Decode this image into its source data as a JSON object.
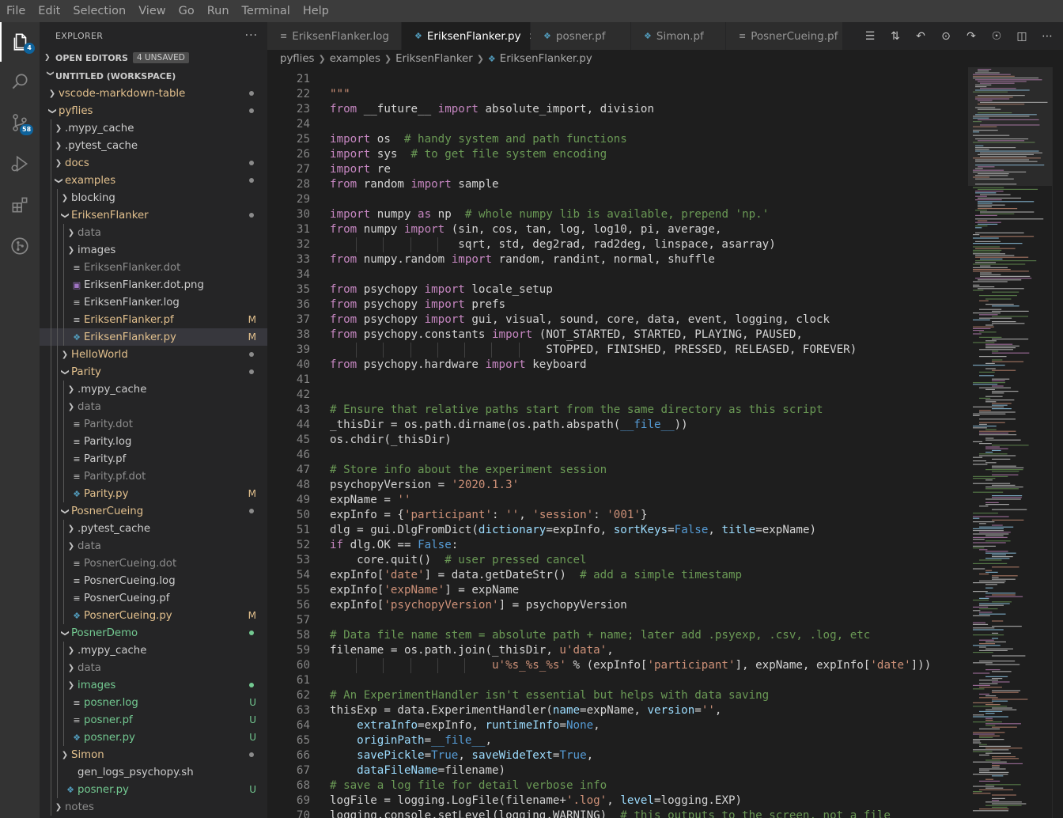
{
  "menu": [
    "File",
    "Edit",
    "Selection",
    "View",
    "Go",
    "Run",
    "Terminal",
    "Help"
  ],
  "activity": {
    "explorer_badge": "4",
    "scm_badge": "58"
  },
  "sidebar": {
    "title": "EXPLORER",
    "more": "···",
    "open_editors": {
      "label": "OPEN EDITORS",
      "badge": "4 UNSAVED"
    },
    "workspace": {
      "label": "UNTITLED (WORKSPACE)"
    },
    "tree": [
      {
        "label": "vscode-markdown-table",
        "kind": "folder",
        "open": false,
        "depth": 0,
        "color": "#e2c08d",
        "dot": "#8b8b8b"
      },
      {
        "label": "pyflies",
        "kind": "folder",
        "open": true,
        "depth": 0,
        "color": "#e2c08d",
        "dot": "#8b8b8b"
      },
      {
        "label": ".mypy_cache",
        "kind": "folder",
        "open": false,
        "depth": 1,
        "color": "#cccccc"
      },
      {
        "label": ".pytest_cache",
        "kind": "folder",
        "open": false,
        "depth": 1,
        "color": "#cccccc"
      },
      {
        "label": "docs",
        "kind": "folder",
        "open": false,
        "depth": 1,
        "color": "#e2c08d",
        "dot": "#8b8b8b"
      },
      {
        "label": "examples",
        "kind": "folder",
        "open": true,
        "depth": 1,
        "color": "#e2c08d",
        "dot": "#8b8b8b"
      },
      {
        "label": "blocking",
        "kind": "folder",
        "open": false,
        "depth": 2,
        "color": "#cccccc"
      },
      {
        "label": "EriksenFlanker",
        "kind": "folder",
        "open": true,
        "depth": 2,
        "color": "#e2c08d",
        "dot": "#8b8b8b"
      },
      {
        "label": "data",
        "kind": "folder",
        "open": false,
        "depth": 3,
        "color": "#8c8c8c"
      },
      {
        "label": "images",
        "kind": "folder",
        "open": false,
        "depth": 3,
        "color": "#cccccc"
      },
      {
        "label": "EriksenFlanker.dot",
        "kind": "file",
        "icon": "lines",
        "depth": 3,
        "color": "#8c8c8c"
      },
      {
        "label": "EriksenFlanker.dot.png",
        "kind": "file",
        "icon": "image",
        "depth": 3,
        "color": "#cccccc"
      },
      {
        "label": "EriksenFlanker.log",
        "kind": "file",
        "icon": "lines",
        "depth": 3,
        "color": "#cccccc"
      },
      {
        "label": "EriksenFlanker.pf",
        "kind": "file",
        "icon": "lines",
        "depth": 3,
        "color": "#e2c08d",
        "deco": "M",
        "deco_color": "#e2c08d"
      },
      {
        "label": "EriksenFlanker.py",
        "kind": "file",
        "icon": "python",
        "depth": 3,
        "color": "#e2c08d",
        "deco": "M",
        "deco_color": "#e2c08d",
        "selected": true
      },
      {
        "label": "HelloWorld",
        "kind": "folder",
        "open": false,
        "depth": 2,
        "color": "#e2c08d",
        "dot": "#8b8b8b"
      },
      {
        "label": "Parity",
        "kind": "folder",
        "open": true,
        "depth": 2,
        "color": "#e2c08d",
        "dot": "#8b8b8b"
      },
      {
        "label": ".mypy_cache",
        "kind": "folder",
        "open": false,
        "depth": 3,
        "color": "#cccccc"
      },
      {
        "label": "data",
        "kind": "folder",
        "open": false,
        "depth": 3,
        "color": "#8c8c8c"
      },
      {
        "label": "Parity.dot",
        "kind": "file",
        "icon": "lines",
        "depth": 3,
        "color": "#8c8c8c"
      },
      {
        "label": "Parity.log",
        "kind": "file",
        "icon": "lines",
        "depth": 3,
        "color": "#cccccc"
      },
      {
        "label": "Parity.pf",
        "kind": "file",
        "icon": "lines",
        "depth": 3,
        "color": "#cccccc"
      },
      {
        "label": "Parity.pf.dot",
        "kind": "file",
        "icon": "lines",
        "depth": 3,
        "color": "#8c8c8c"
      },
      {
        "label": "Parity.py",
        "kind": "file",
        "icon": "python",
        "depth": 3,
        "color": "#e2c08d",
        "deco": "M",
        "deco_color": "#e2c08d"
      },
      {
        "label": "PosnerCueing",
        "kind": "folder",
        "open": true,
        "depth": 2,
        "color": "#e2c08d",
        "dot": "#8b8b8b"
      },
      {
        "label": ".pytest_cache",
        "kind": "folder",
        "open": false,
        "depth": 3,
        "color": "#cccccc"
      },
      {
        "label": "data",
        "kind": "folder",
        "open": false,
        "depth": 3,
        "color": "#8c8c8c"
      },
      {
        "label": "PosnerCueing.dot",
        "kind": "file",
        "icon": "lines",
        "depth": 3,
        "color": "#8c8c8c"
      },
      {
        "label": "PosnerCueing.log",
        "kind": "file",
        "icon": "lines",
        "depth": 3,
        "color": "#cccccc"
      },
      {
        "label": "PosnerCueing.pf",
        "kind": "file",
        "icon": "lines",
        "depth": 3,
        "color": "#cccccc"
      },
      {
        "label": "PosnerCueing.py",
        "kind": "file",
        "icon": "python",
        "depth": 3,
        "color": "#e2c08d",
        "deco": "M",
        "deco_color": "#e2c08d"
      },
      {
        "label": "PosnerDemo",
        "kind": "folder",
        "open": true,
        "depth": 2,
        "color": "#73c991",
        "dot": "#73c991"
      },
      {
        "label": ".mypy_cache",
        "kind": "folder",
        "open": false,
        "depth": 3,
        "color": "#cccccc"
      },
      {
        "label": "data",
        "kind": "folder",
        "open": false,
        "depth": 3,
        "color": "#8c8c8c"
      },
      {
        "label": "images",
        "kind": "folder",
        "open": false,
        "depth": 3,
        "color": "#73c991",
        "dot": "#73c991"
      },
      {
        "label": "posner.log",
        "kind": "file",
        "icon": "lines",
        "depth": 3,
        "color": "#73c991",
        "deco": "U",
        "deco_color": "#73c991"
      },
      {
        "label": "posner.pf",
        "kind": "file",
        "icon": "lines",
        "depth": 3,
        "color": "#73c991",
        "deco": "U",
        "deco_color": "#73c991"
      },
      {
        "label": "posner.py",
        "kind": "file",
        "icon": "python",
        "depth": 3,
        "color": "#73c991",
        "deco": "U",
        "deco_color": "#73c991"
      },
      {
        "label": "Simon",
        "kind": "folder",
        "open": false,
        "depth": 2,
        "color": "#e2c08d",
        "dot": "#8b8b8b"
      },
      {
        "label": "gen_logs_psychopy.sh",
        "kind": "file",
        "icon": "none",
        "depth": 2,
        "color": "#cccccc"
      },
      {
        "label": "posner.py",
        "kind": "file",
        "icon": "python",
        "depth": 2,
        "color": "#73c991",
        "deco": "U",
        "deco_color": "#73c991"
      },
      {
        "label": "notes",
        "kind": "folder",
        "open": false,
        "depth": 1,
        "color": "#8c8c8c"
      }
    ]
  },
  "tabs": [
    {
      "label": "EriksenFlanker.log",
      "icon": "lines",
      "active": false,
      "state": "dirty"
    },
    {
      "label": "EriksenFlanker.py",
      "icon": "python",
      "active": true,
      "state": "close"
    },
    {
      "label": "posner.pf",
      "icon": "python",
      "active": false,
      "state": "none"
    },
    {
      "label": "Simon.pf",
      "icon": "python",
      "active": false,
      "state": "none"
    },
    {
      "label": "PosnerCueing.pf",
      "icon": "lines",
      "active": false,
      "state": "none"
    }
  ],
  "breadcrumb": [
    "pyflies",
    "examples",
    "EriksenFlanker",
    "EriksenFlanker.py"
  ],
  "code": {
    "first_line": 21,
    "lines": [
      [],
      [
        [
          "\"\"\"",
          "str"
        ]
      ],
      [
        [
          "from",
          "kw"
        ],
        [
          " __future__ ",
          ""
        ],
        [
          "import",
          "kw"
        ],
        [
          " absolute_import, division",
          ""
        ]
      ],
      [],
      [
        [
          "import",
          "kw"
        ],
        [
          " os  ",
          ""
        ],
        [
          "# handy system and path functions",
          "cm"
        ]
      ],
      [
        [
          "import",
          "kw"
        ],
        [
          " sys  ",
          ""
        ],
        [
          "# to get file system encoding",
          "cm"
        ]
      ],
      [
        [
          "import",
          "kw"
        ],
        [
          " re",
          ""
        ]
      ],
      [
        [
          "from",
          "kw"
        ],
        [
          " random ",
          ""
        ],
        [
          "import",
          "kw"
        ],
        [
          " sample",
          ""
        ]
      ],
      [],
      [
        [
          "import",
          "kw"
        ],
        [
          " numpy ",
          ""
        ],
        [
          "as",
          "kw"
        ],
        [
          " np  ",
          ""
        ],
        [
          "# whole numpy lib is available, prepend 'np.'",
          "cm"
        ]
      ],
      [
        [
          "from",
          "kw"
        ],
        [
          " numpy ",
          ""
        ],
        [
          "import",
          "kw"
        ],
        [
          " (sin, cos, tan, log, log10, pi, average,",
          ""
        ]
      ],
      [
        [
          "                   sqrt, std, deg2rad, rad2deg, linspace, asarray)",
          ""
        ]
      ],
      [
        [
          "from",
          "kw"
        ],
        [
          " numpy.random ",
          ""
        ],
        [
          "import",
          "kw"
        ],
        [
          " random, randint, normal, shuffle",
          ""
        ]
      ],
      [],
      [
        [
          "from",
          "kw"
        ],
        [
          " psychopy ",
          ""
        ],
        [
          "import",
          "kw"
        ],
        [
          " locale_setup",
          ""
        ]
      ],
      [
        [
          "from",
          "kw"
        ],
        [
          " psychopy ",
          ""
        ],
        [
          "import",
          "kw"
        ],
        [
          " prefs",
          ""
        ]
      ],
      [
        [
          "from",
          "kw"
        ],
        [
          " psychopy ",
          ""
        ],
        [
          "import",
          "kw"
        ],
        [
          " gui, visual, sound, core, data, event, logging, clock",
          ""
        ]
      ],
      [
        [
          "from",
          "kw"
        ],
        [
          " psychopy.constants ",
          ""
        ],
        [
          "import",
          "kw"
        ],
        [
          " (NOT_STARTED, STARTED, PLAYING, PAUSED,",
          ""
        ]
      ],
      [
        [
          "                                STOPPED, FINISHED, PRESSED, RELEASED, FOREVER)",
          ""
        ]
      ],
      [
        [
          "from",
          "kw"
        ],
        [
          " psychopy.hardware ",
          ""
        ],
        [
          "import",
          "kw"
        ],
        [
          " keyboard",
          ""
        ]
      ],
      [],
      [],
      [
        [
          "# Ensure that relative paths start from the same directory as this script",
          "cm"
        ]
      ],
      [
        [
          "_thisDir = os.path.dirname(os.path.abspath(",
          ""
        ],
        [
          "__file__",
          "kb"
        ],
        [
          "))",
          ""
        ]
      ],
      [
        [
          "os.chdir(_thisDir)",
          ""
        ]
      ],
      [],
      [
        [
          "# Store info about the experiment session",
          "cm"
        ]
      ],
      [
        [
          "psychopyVersion = ",
          ""
        ],
        [
          "'2020.1.3'",
          "str"
        ]
      ],
      [
        [
          "expName = ",
          ""
        ],
        [
          "''",
          "str"
        ]
      ],
      [
        [
          "expInfo = {",
          ""
        ],
        [
          "'participant'",
          "str"
        ],
        [
          ": ",
          ""
        ],
        [
          "''",
          "str"
        ],
        [
          ", ",
          ""
        ],
        [
          "'session'",
          "str"
        ],
        [
          ": ",
          ""
        ],
        [
          "'001'",
          "str"
        ],
        [
          "}",
          ""
        ]
      ],
      [
        [
          "dlg = gui.DlgFromDict(",
          ""
        ],
        [
          "dictionary",
          "nm"
        ],
        [
          "=expInfo, ",
          ""
        ],
        [
          "sortKeys",
          "nm"
        ],
        [
          "=",
          ""
        ],
        [
          "False",
          "kb"
        ],
        [
          ", ",
          ""
        ],
        [
          "title",
          "nm"
        ],
        [
          "=expName)",
          ""
        ]
      ],
      [
        [
          "if",
          "kw"
        ],
        [
          " dlg.OK == ",
          ""
        ],
        [
          "False",
          "kb"
        ],
        [
          ":",
          ""
        ]
      ],
      [
        [
          "    core.quit()  ",
          ""
        ],
        [
          "# user pressed cancel",
          "cm"
        ]
      ],
      [
        [
          "expInfo[",
          ""
        ],
        [
          "'date'",
          "str"
        ],
        [
          "] = data.getDateStr()  ",
          ""
        ],
        [
          "# add a simple timestamp",
          "cm"
        ]
      ],
      [
        [
          "expInfo[",
          ""
        ],
        [
          "'expName'",
          "str"
        ],
        [
          "] = expName",
          ""
        ]
      ],
      [
        [
          "expInfo[",
          ""
        ],
        [
          "'psychopyVersion'",
          "str"
        ],
        [
          "] = psychopyVersion",
          ""
        ]
      ],
      [],
      [
        [
          "# Data file name stem = absolute path + name; later add .psyexp, .csv, .log, etc",
          "cm"
        ]
      ],
      [
        [
          "filename = os.path.join(_thisDir, ",
          ""
        ],
        [
          "u'data'",
          "str"
        ],
        [
          ",",
          ""
        ]
      ],
      [
        [
          "                        ",
          ""
        ],
        [
          "u'%s_%s_%s'",
          "str"
        ],
        [
          " % (expInfo[",
          ""
        ],
        [
          "'participant'",
          "str"
        ],
        [
          "], expName, expInfo[",
          ""
        ],
        [
          "'date'",
          "str"
        ],
        [
          "]))",
          ""
        ]
      ],
      [],
      [
        [
          "# An ExperimentHandler isn't essential but helps with data saving",
          "cm"
        ]
      ],
      [
        [
          "thisExp = data.ExperimentHandler(",
          ""
        ],
        [
          "name",
          "nm"
        ],
        [
          "=expName, ",
          ""
        ],
        [
          "version",
          "nm"
        ],
        [
          "=",
          ""
        ],
        [
          "''",
          "str"
        ],
        [
          ",",
          ""
        ]
      ],
      [
        [
          "    ",
          ""
        ],
        [
          "extraInfo",
          "nm"
        ],
        [
          "=expInfo, ",
          ""
        ],
        [
          "runtimeInfo",
          "nm"
        ],
        [
          "=",
          ""
        ],
        [
          "None",
          "kb"
        ],
        [
          ",",
          ""
        ]
      ],
      [
        [
          "    ",
          ""
        ],
        [
          "originPath",
          "nm"
        ],
        [
          "=",
          ""
        ],
        [
          "__file__",
          "kb"
        ],
        [
          ",",
          ""
        ]
      ],
      [
        [
          "    ",
          ""
        ],
        [
          "savePickle",
          "nm"
        ],
        [
          "=",
          ""
        ],
        [
          "True",
          "kb"
        ],
        [
          ", ",
          ""
        ],
        [
          "saveWideText",
          "nm"
        ],
        [
          "=",
          ""
        ],
        [
          "True",
          "kb"
        ],
        [
          ",",
          ""
        ]
      ],
      [
        [
          "    ",
          ""
        ],
        [
          "dataFileName",
          "nm"
        ],
        [
          "=filename)",
          ""
        ]
      ],
      [
        [
          "# save a log file for detail verbose info",
          "cm"
        ]
      ],
      [
        [
          "logFile = logging.LogFile(filename+",
          ""
        ],
        [
          "'.log'",
          "str"
        ],
        [
          ", ",
          ""
        ],
        [
          "level",
          "nm"
        ],
        [
          "=logging.EXP)",
          ""
        ]
      ],
      [
        [
          "logging.console.setLevel(logging.WARNING)  ",
          ""
        ],
        [
          "# this outputs to the screen, not a file",
          "cm"
        ]
      ]
    ]
  },
  "colors": {
    "accent": "#0e639c",
    "modified": "#e2c08d",
    "untracked": "#73c991"
  }
}
